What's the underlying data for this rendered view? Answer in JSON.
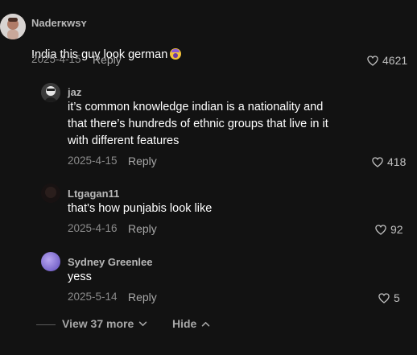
{
  "comments": [
    {
      "username": "Naderĸwsʏ",
      "text": "India this guy look german",
      "emoji": "shocked-face-emoji",
      "date": "2025-4-15",
      "reply_label": "Reply",
      "likes": "4621"
    },
    {
      "username": "jaz",
      "text": "it’s common knowledge indian is a nationality and\nthat there’s hundreds of ethnic groups that live in it\nwith different features",
      "date": "2025-4-15",
      "reply_label": "Reply",
      "likes": "418"
    },
    {
      "username": "Ltgagan11",
      "text": "that's how punjabis look like",
      "date": "2025-4-16",
      "reply_label": "Reply",
      "likes": "92"
    },
    {
      "username": "Sydney Greenlee",
      "text": "yess",
      "date": "2025-5-14",
      "reply_label": "Reply",
      "likes": "5"
    }
  ],
  "replies_footer": {
    "view_more_label": "View 37 more",
    "hide_label": "Hide"
  },
  "colors": {
    "background": "#121212",
    "username": "#b8b8b8",
    "meta": "#8a8a8a"
  }
}
